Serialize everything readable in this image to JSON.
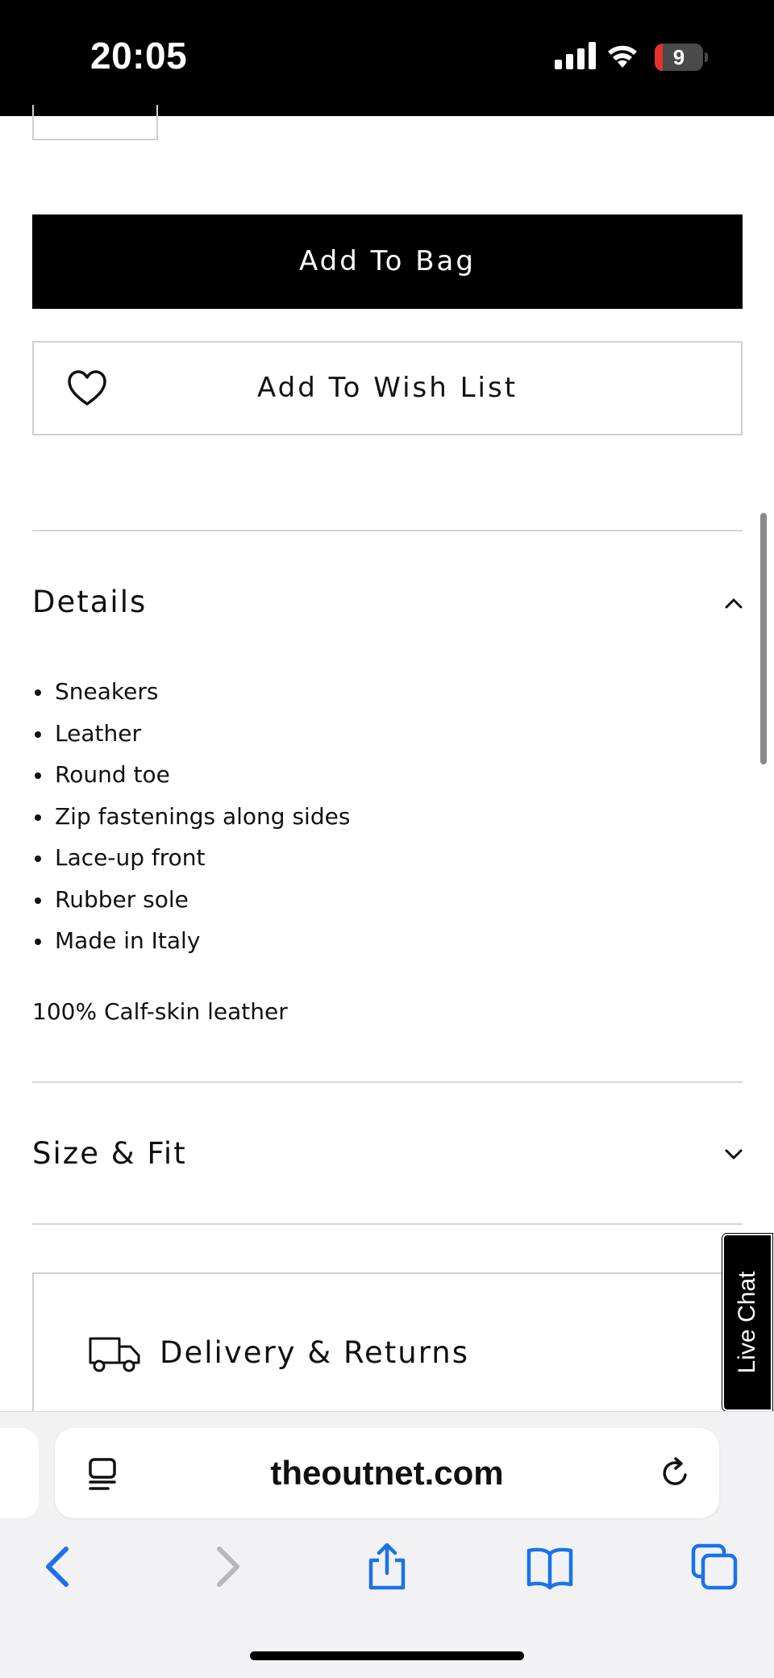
{
  "status_bar": {
    "time": "20:05",
    "battery_level": "9",
    "battery_color": "#e6322e"
  },
  "product": {
    "add_to_bag_label": "Add To Bag",
    "add_to_wish_list_label": "Add To Wish List"
  },
  "details": {
    "title": "Details",
    "expanded": true,
    "items": [
      "Sneakers",
      "Leather",
      "Round toe",
      "Zip fastenings along sides",
      "Lace-up front",
      "Rubber sole",
      "Made in Italy"
    ],
    "material": "100% Calf-skin leather"
  },
  "size_fit": {
    "title": "Size & Fit",
    "expanded": false
  },
  "delivery": {
    "title": "Delivery & Returns"
  },
  "live_chat": {
    "label": "Live Chat"
  },
  "browser": {
    "url": "theoutnet.com",
    "accent_color": "#1a73e8",
    "icons": [
      "reader-view-icon",
      "reload-icon",
      "back-icon",
      "forward-icon",
      "share-icon",
      "bookmarks-icon",
      "tabs-icon"
    ]
  }
}
